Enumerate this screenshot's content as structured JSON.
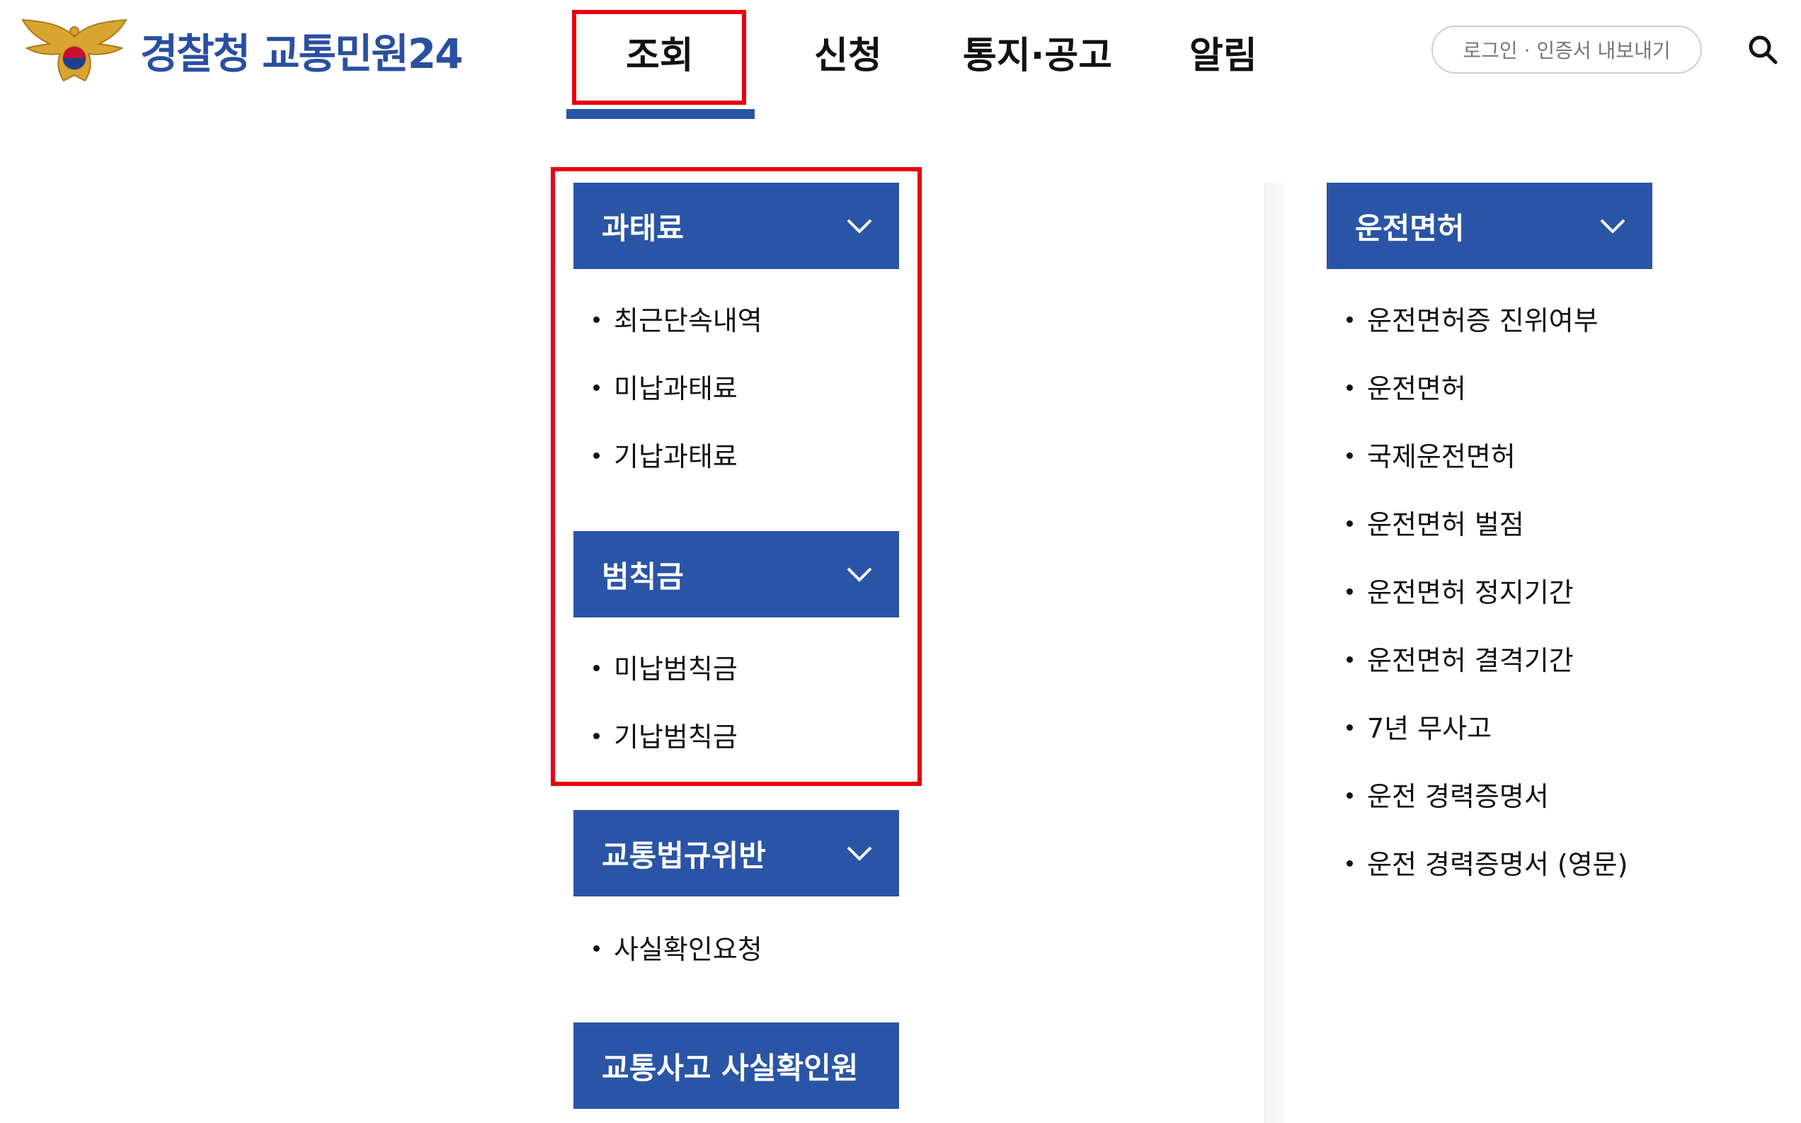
{
  "header": {
    "logo_text": "경찰청 교통민원24",
    "nav": [
      {
        "label": "조회"
      },
      {
        "label": "신청"
      },
      {
        "label": "통지·공고"
      },
      {
        "label": "알림"
      }
    ],
    "login_label": "로그인 · 인증서 내보내기"
  },
  "menu": {
    "left_sections": [
      {
        "title": "과태료",
        "items": [
          "최근단속내역",
          "미납과태료",
          "기납과태료"
        ]
      },
      {
        "title": "범칙금",
        "items": [
          "미납범칙금",
          "기납범칙금"
        ]
      },
      {
        "title": "교통법규위반",
        "items": [
          "사실확인요청"
        ]
      },
      {
        "title": "교통사고 사실확인원",
        "items": []
      }
    ],
    "right_sections": [
      {
        "title": "운전면허",
        "items": [
          "운전면허증 진위여부",
          "운전면허",
          "국제운전면허",
          "운전면허 벌점",
          "운전면허 정지기간",
          "운전면허 결격기간",
          "7년 무사고",
          "운전 경력증명서",
          "운전 경력증명서 (영문)"
        ]
      }
    ]
  },
  "colors": {
    "accent": "#2a55a6",
    "highlight": "#e60012",
    "logo_gold": "#d9a531"
  },
  "icons": {
    "emblem": "police-eagle-emblem-icon",
    "search": "search-icon",
    "expand": "chevron-down-icon"
  }
}
